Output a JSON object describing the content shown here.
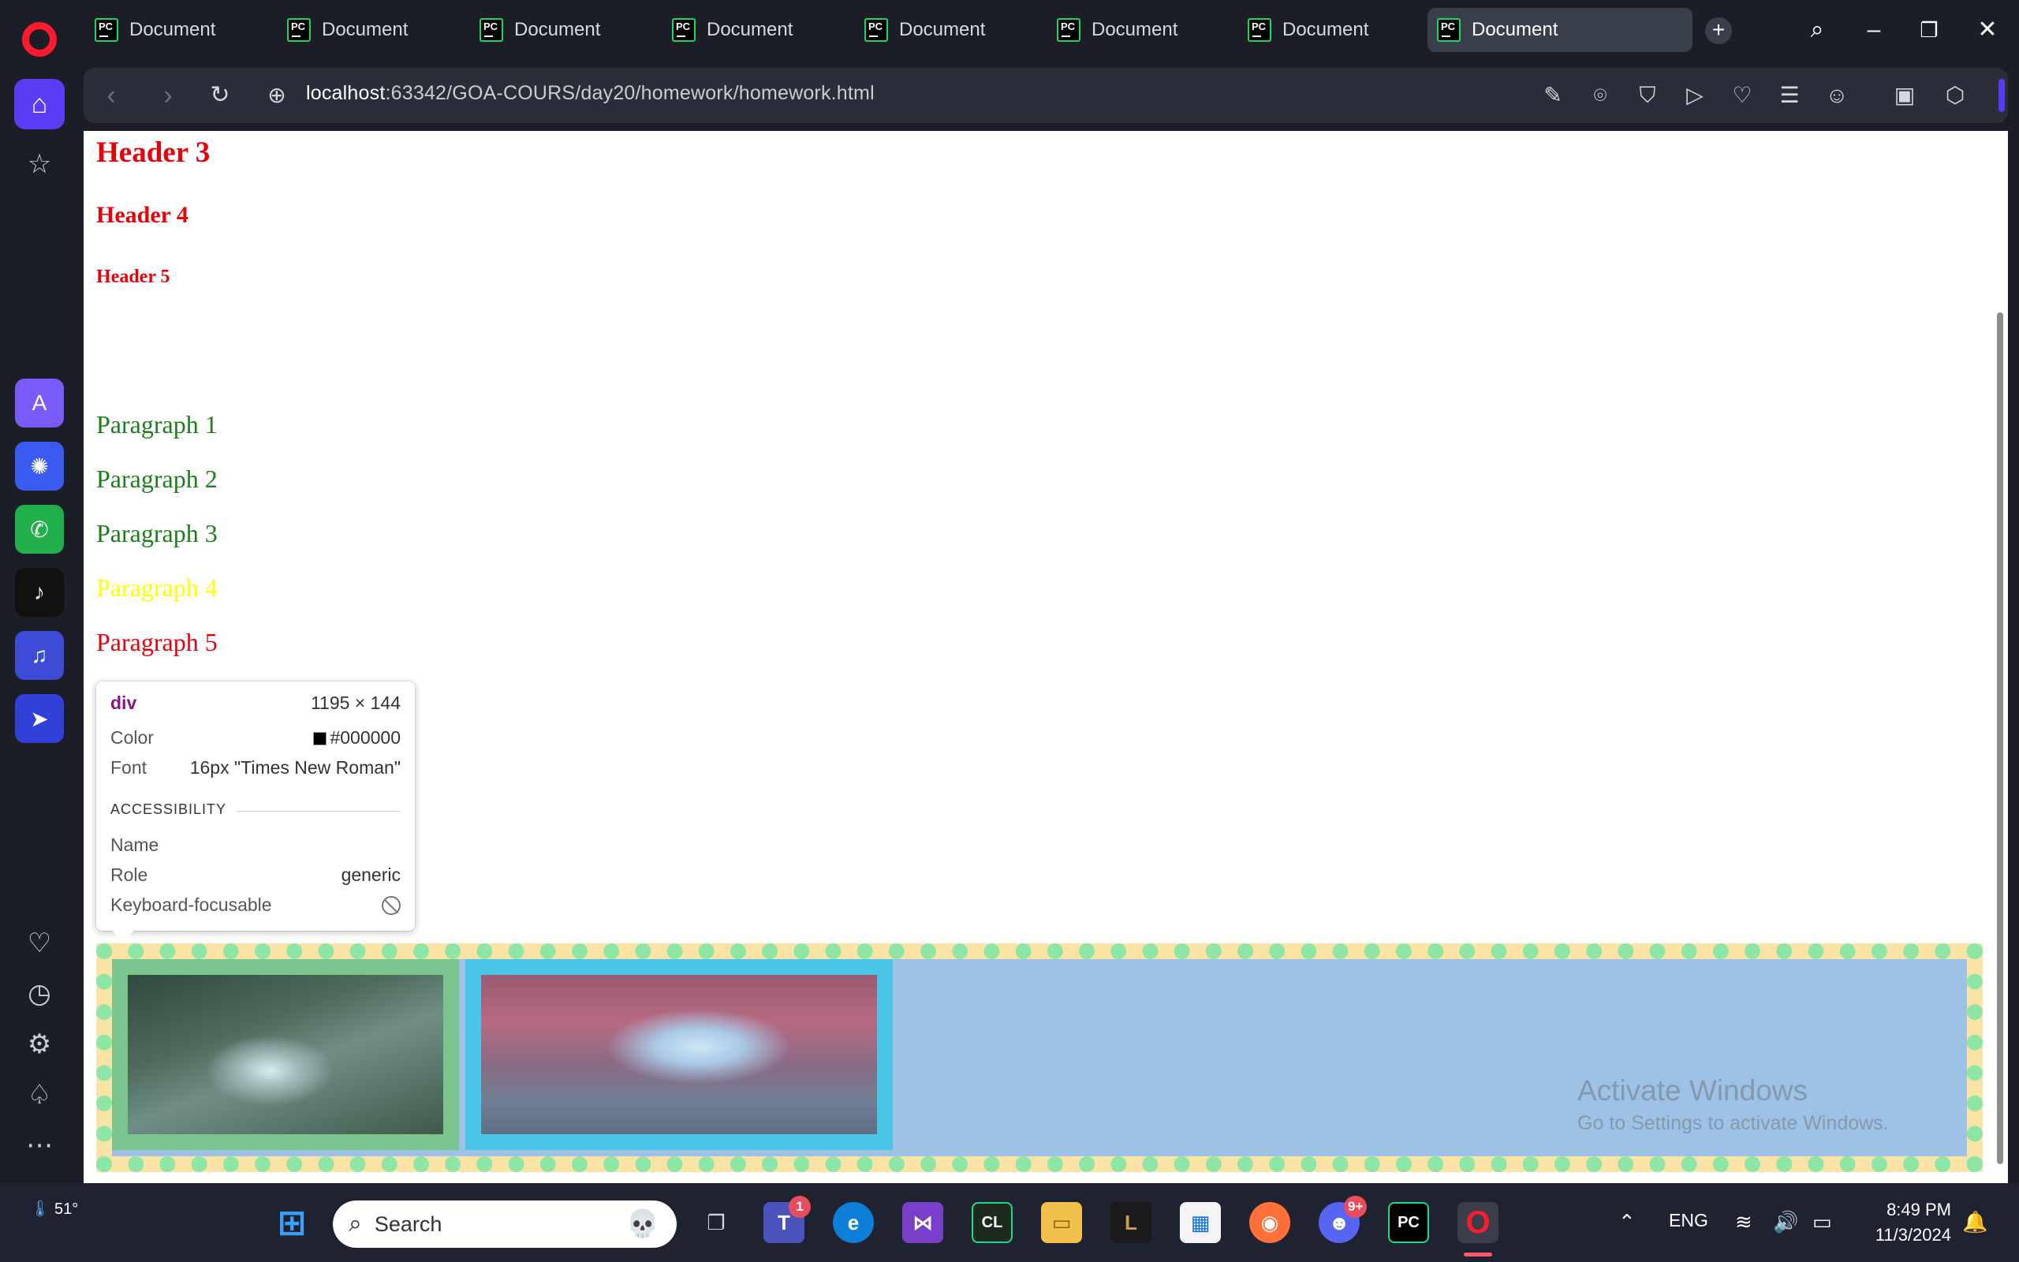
{
  "browser": {
    "tabs": [
      {
        "label": "Document"
      },
      {
        "label": "Document"
      },
      {
        "label": "Document"
      },
      {
        "label": "Document"
      },
      {
        "label": "Document"
      },
      {
        "label": "Document"
      },
      {
        "label": "Document"
      },
      {
        "label": "Document"
      }
    ],
    "active_tab": 7,
    "url_host": "localhost",
    "url_path": ":63342/GOA-COURS/day20/homework/homework.html"
  },
  "page": {
    "headers": {
      "h3": "Header 3",
      "h4": "Header 4",
      "h5": "Header 5"
    },
    "paragraphs": [
      {
        "text": "Paragraph 1",
        "color": "#1a7f1a"
      },
      {
        "text": "Paragraph 2",
        "color": "#1a7f1a"
      },
      {
        "text": "Paragraph 3",
        "color": "#1a7f1a"
      },
      {
        "text": "Paragraph 4",
        "color": "#ffff00"
      },
      {
        "text": "Paragraph 5",
        "color": "#e8000b"
      }
    ],
    "watermark": {
      "title": "Activate Windows",
      "subtitle": "Go to Settings to activate Windows."
    }
  },
  "inspect_tooltip": {
    "tag": "div",
    "size": "1195 × 144",
    "color_label": "Color",
    "color_value": "#000000",
    "font_label": "Font",
    "font_value": "16px \"Times New Roman\"",
    "section": "ACCESSIBILITY",
    "name_label": "Name",
    "name_value": "",
    "role_label": "Role",
    "role_value": "generic",
    "focusable_label": "Keyboard-focusable"
  },
  "taskbar": {
    "weather": "51°",
    "search_placeholder": "Search",
    "teams_badge": "1",
    "discord_badge": "9+",
    "language": "ENG",
    "time": "8:49 PM",
    "date": "11/3/2024"
  }
}
